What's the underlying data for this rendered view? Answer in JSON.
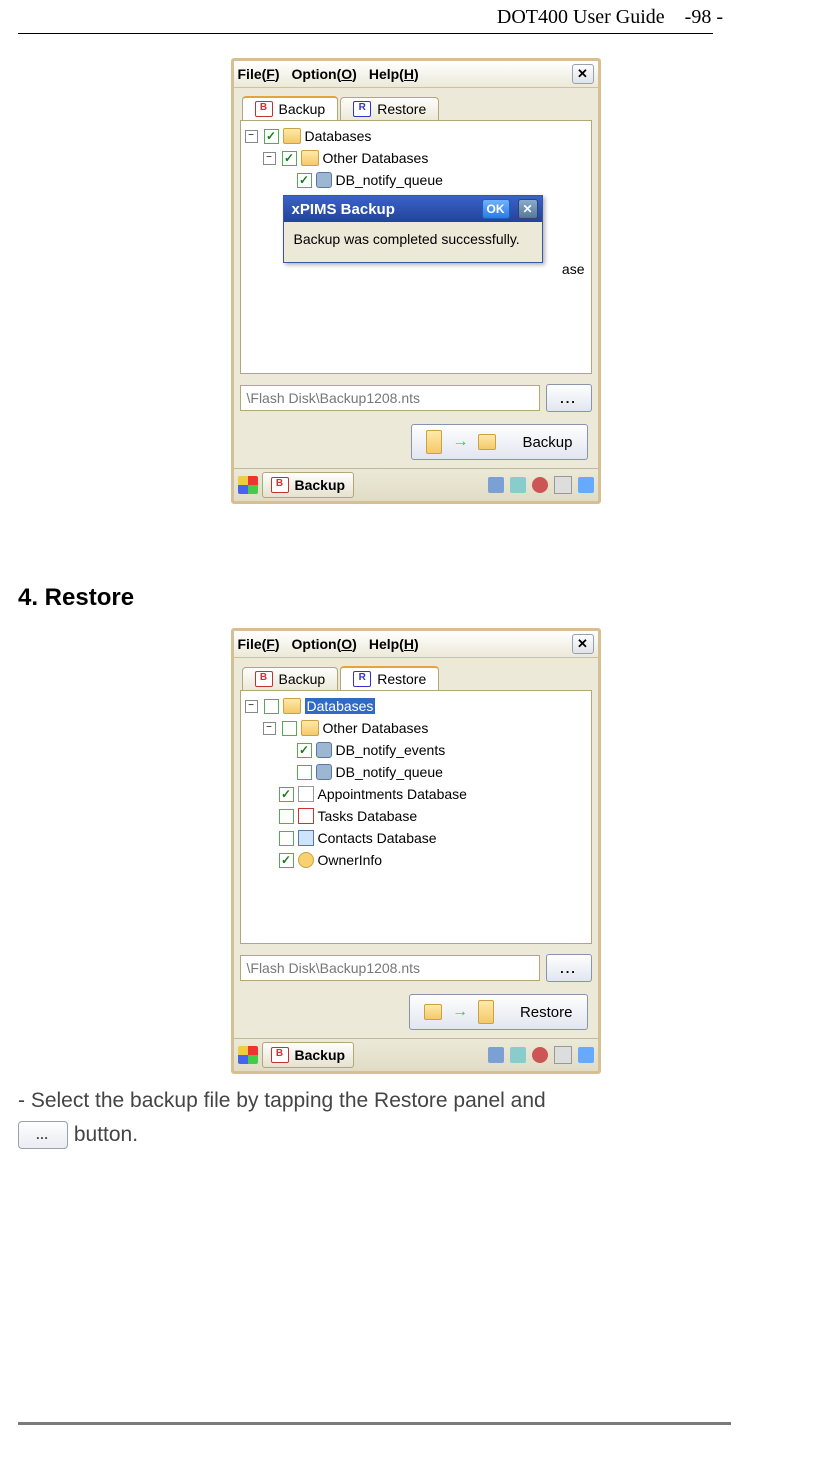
{
  "header": {
    "title": "DOT400 User Guide",
    "page": "-98 -"
  },
  "section": {
    "heading": "4. Restore"
  },
  "body": {
    "line1": "- Select the backup file by tapping the Restore panel and",
    "line2_suffix": " button."
  },
  "screenshot1": {
    "menu": {
      "file": "File(",
      "file_u": "F",
      "file_end": ")",
      "option": "Option(",
      "option_u": "O",
      "option_end": ")",
      "help": "Help(",
      "help_u": "H",
      "help_end": ")"
    },
    "close": "✕",
    "tabs": {
      "backup": "Backup",
      "restore": "Restore"
    },
    "tree": {
      "root": "Databases",
      "sub": "Other Databases",
      "item1": "DB_notify_queue",
      "overflow": "ase"
    },
    "popup": {
      "title": "xPIMS Backup",
      "ok": "OK",
      "close": "✕",
      "msg": "Backup was completed successfully."
    },
    "path": "\\Flash Disk\\Backup1208.nts",
    "browse": "...",
    "action": "Backup",
    "taskbar": {
      "app": "Backup"
    }
  },
  "screenshot2": {
    "menu": {
      "file": "File(",
      "file_u": "F",
      "file_end": ")",
      "option": "Option(",
      "option_u": "O",
      "option_end": ")",
      "help": "Help(",
      "help_u": "H",
      "help_end": ")"
    },
    "close": "✕",
    "tabs": {
      "backup": "Backup",
      "restore": "Restore"
    },
    "tree": {
      "root": "Databases",
      "sub": "Other Databases",
      "i1": "DB_notify_events",
      "i2": "DB_notify_queue",
      "i3": "Appointments Database",
      "i4": "Tasks Database",
      "i5": "Contacts Database",
      "i6": "OwnerInfo"
    },
    "path": "\\Flash Disk\\Backup1208.nts",
    "browse": "...",
    "action": "Restore",
    "taskbar": {
      "app": "Backup"
    }
  }
}
